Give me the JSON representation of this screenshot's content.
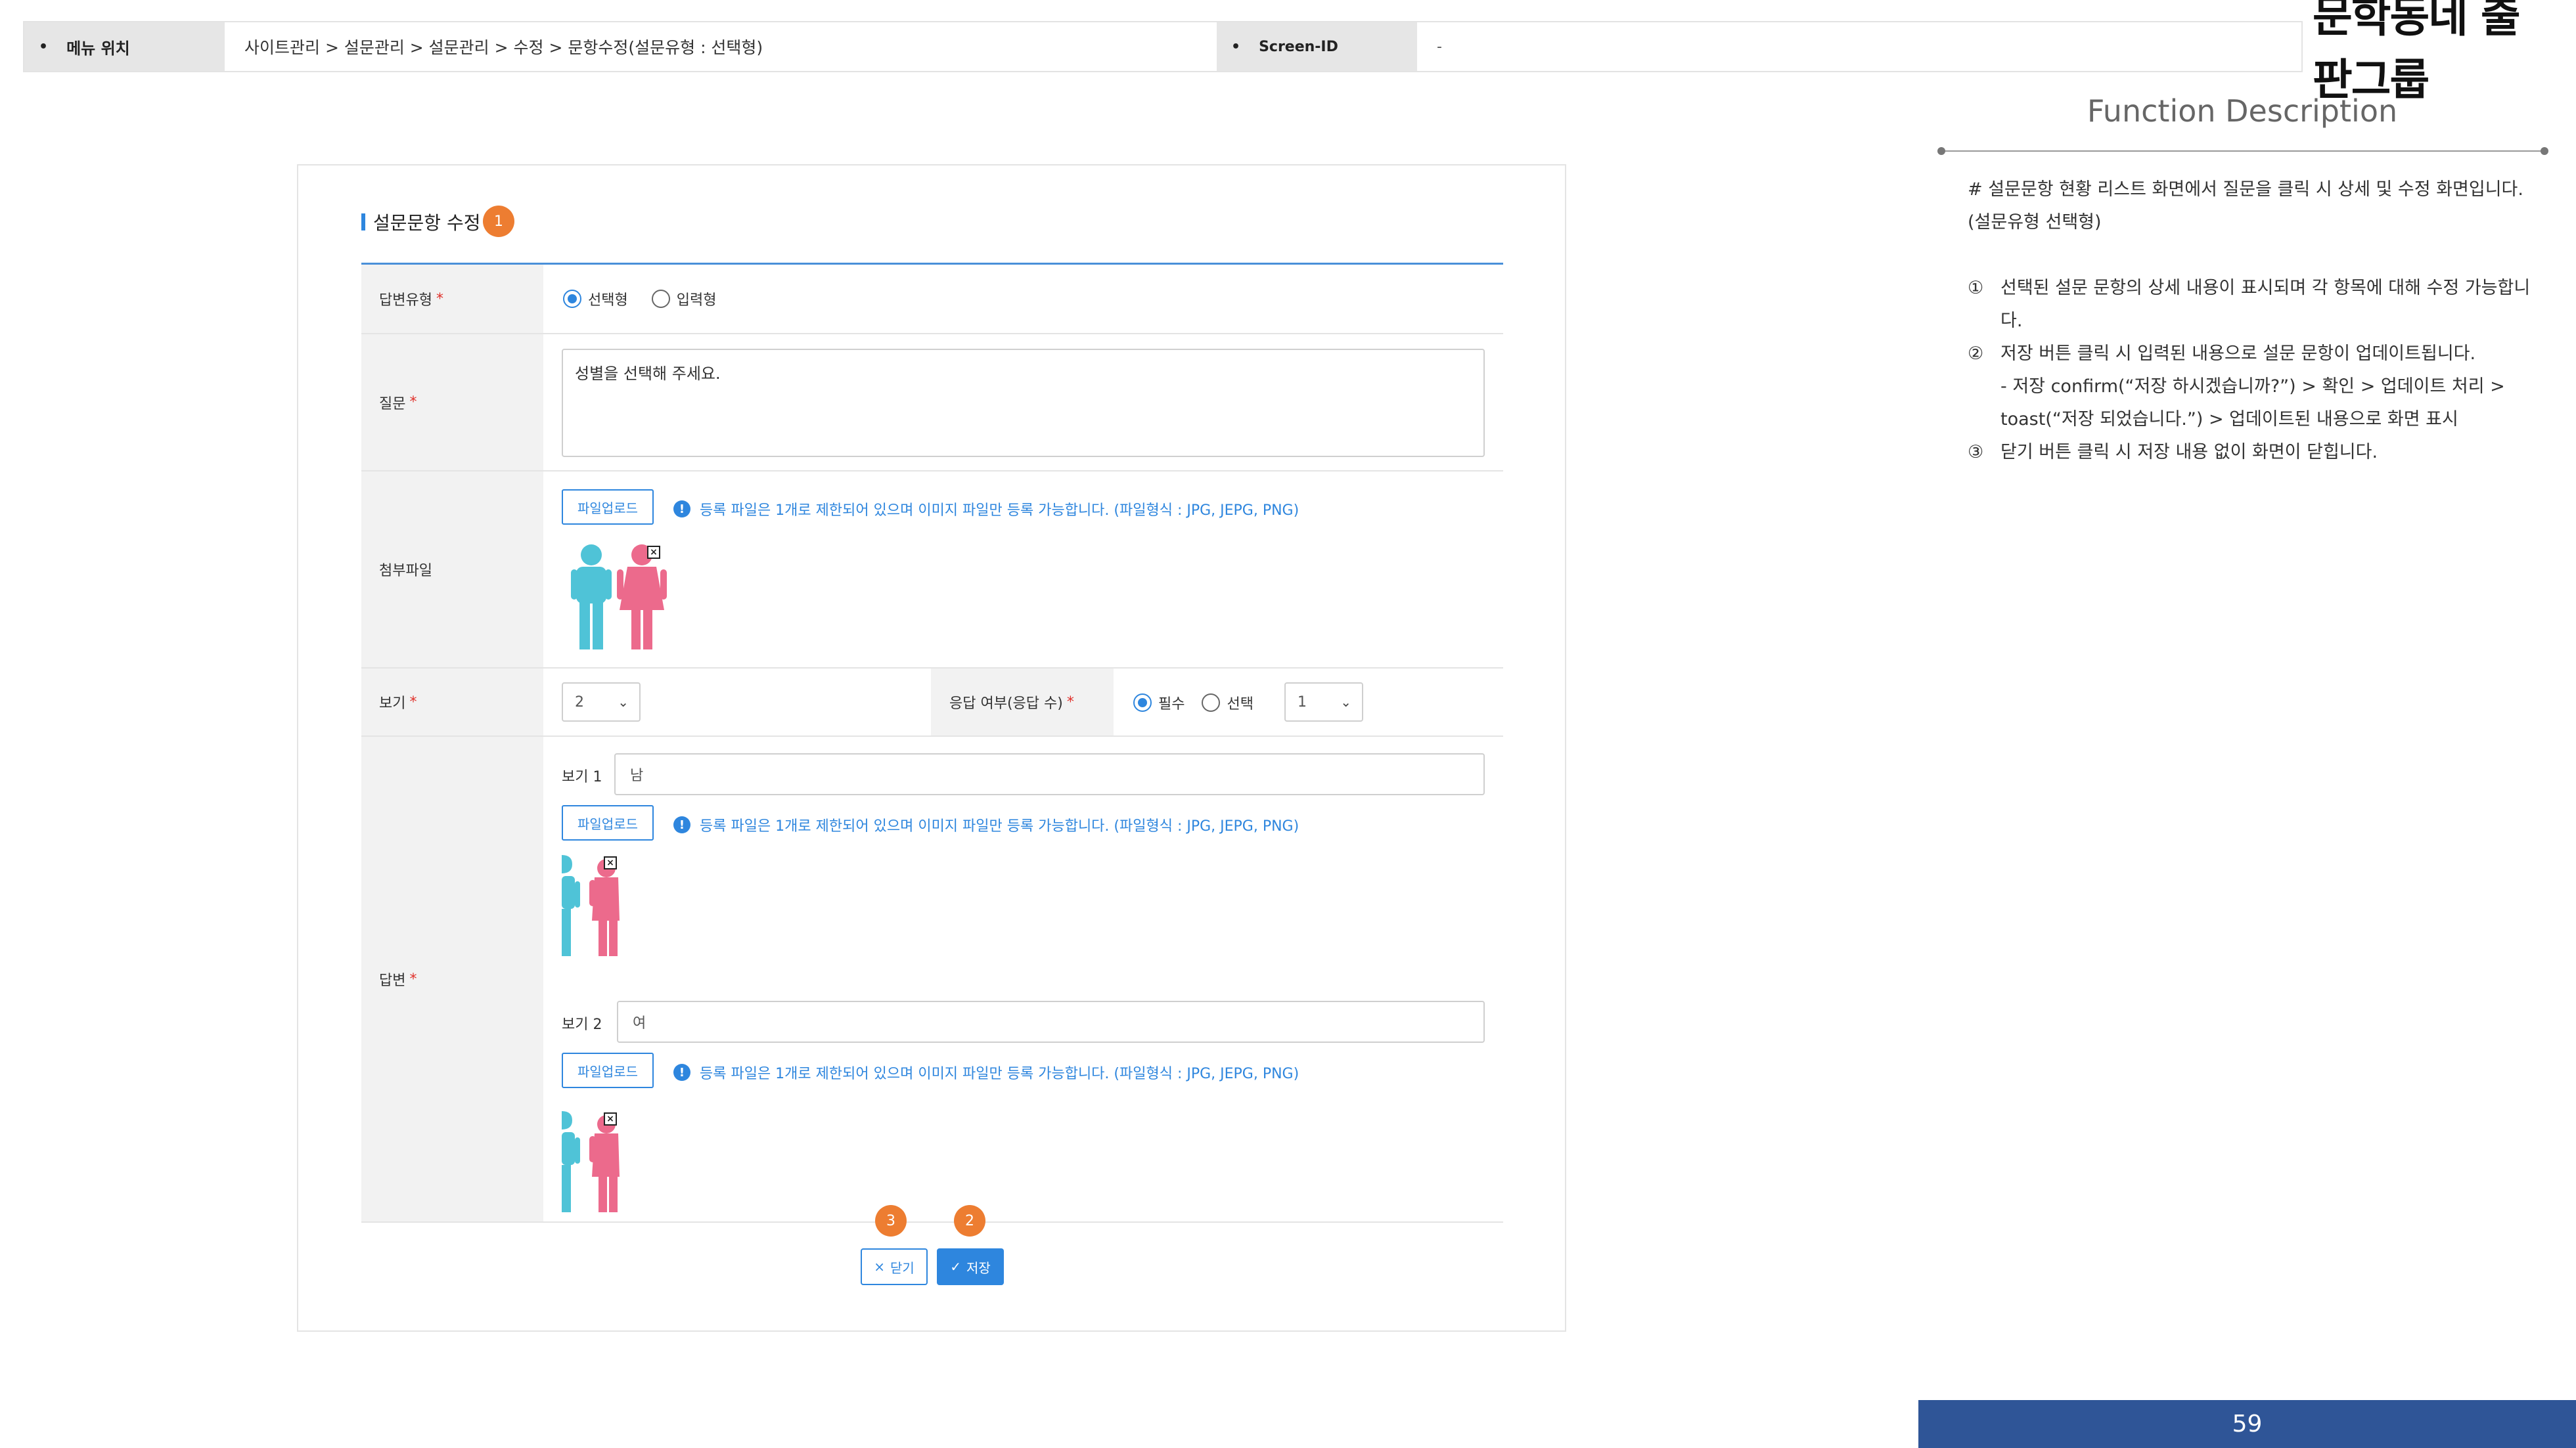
{
  "header": {
    "menu_location_label": "메뉴 위치",
    "breadcrumb": "사이트관리 > 설문관리 > 설문관리 > 수정 > 문항수정(설문유형 : 선택형)",
    "screen_id_label": "Screen-ID",
    "screen_id_value": "-"
  },
  "logo": {
    "text": "문학동네 출판그룹"
  },
  "function_description": {
    "title": "Function Description",
    "intro": "# 설문문항 현황 리스트 화면에서 질문을 클릭 시 상세 및 수정 화면입니다. (설문유형 선택형)",
    "items": [
      {
        "num": "①",
        "text": "선택된 설문 문항의 상세 내용이 표시되며 각 항목에 대해 수정 가능합니다."
      },
      {
        "num": "②",
        "text": "저장 버튼 클릭 시 입력된 내용으로 설문 문항이 업데이트됩니다.\n- 저장 confirm(“저장 하시겠습니까?”) > 확인 > 업데이트 처리 > toast(“저장 되었습니다.”) > 업데이트된 내용으로 화면 표시"
      },
      {
        "num": "③",
        "text": "닫기 버튼 클릭 시 저장 내용 없이 화면이 닫힙니다."
      }
    ]
  },
  "page_number": "59",
  "form": {
    "section_title": "설문문항 수정",
    "badges": {
      "b1": "1",
      "b2": "2",
      "b3": "3"
    },
    "required_mark": "*",
    "answer_type": {
      "label": "답변유형",
      "options": [
        {
          "label": "선택형",
          "checked": true
        },
        {
          "label": "입력형",
          "checked": false
        }
      ]
    },
    "question": {
      "label": "질문",
      "value": "성별을 선택해 주세요."
    },
    "attachment": {
      "label": "첨부파일"
    },
    "upload_button": "파일업로드",
    "upload_notice": "등록 파일은 1개로 제한되어 있으며 이미지 파일만 등록 가능합니다. (파일형식 : JPG, JEPG, PNG)",
    "view_count": {
      "label": "보기",
      "selected": "2"
    },
    "response_required": {
      "label": "응답 여부(응답 수)",
      "options": [
        {
          "label": "필수",
          "checked": true
        },
        {
          "label": "선택",
          "checked": false
        }
      ],
      "count_selected": "1"
    },
    "answer": {
      "label": "답변",
      "options": [
        {
          "label": "보기 1",
          "value": "남"
        },
        {
          "label": "보기 2",
          "value": "여"
        }
      ]
    },
    "buttons": {
      "close": "닫기",
      "save": "저장"
    }
  },
  "colors": {
    "accent": "#2e86de",
    "badge": "#ed7d31",
    "page_bar": "#2f5597",
    "male_figure": "#4fc3d7",
    "female_figure": "#ec6a8c"
  }
}
